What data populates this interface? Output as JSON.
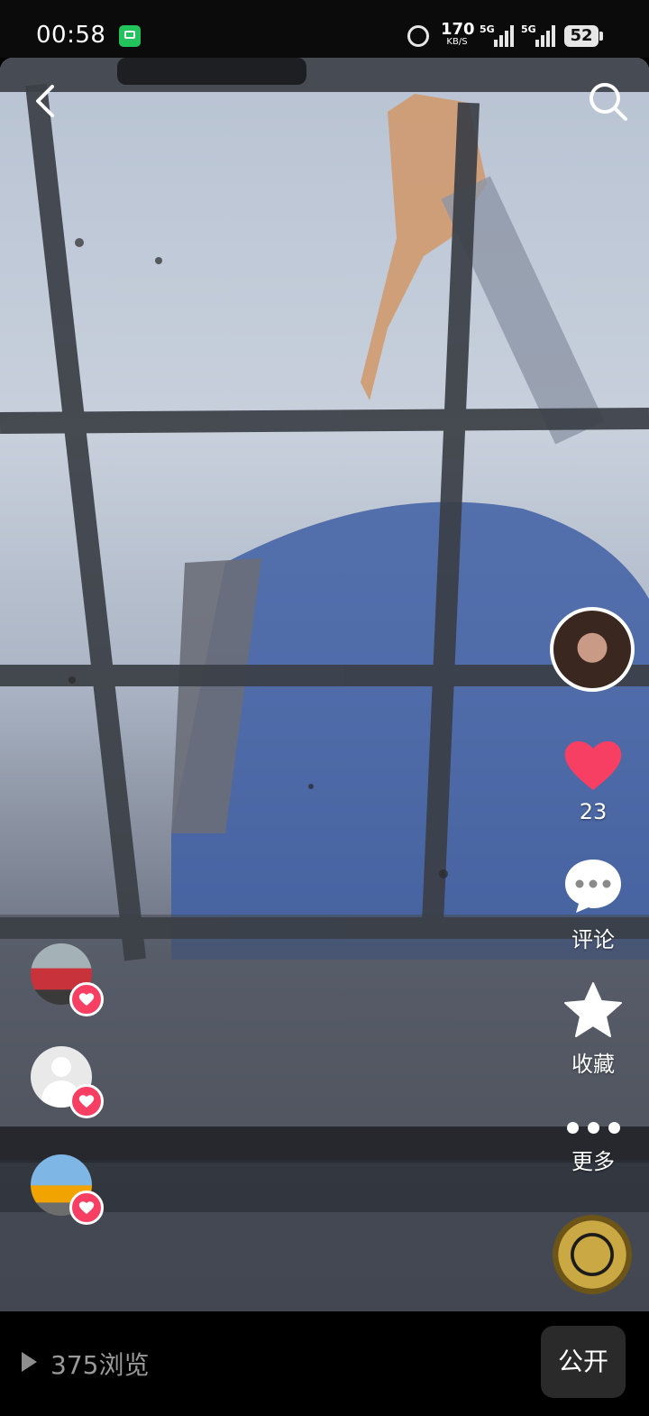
{
  "status_bar": {
    "time": "00:58",
    "net_speed_value": "170",
    "net_speed_unit": "KB/S",
    "sim1_label": "5G",
    "sim2_label": "5G",
    "battery": "52",
    "icons": [
      "message-app-icon",
      "alarm-icon",
      "signal-icon",
      "signal-icon",
      "battery-icon"
    ]
  },
  "header": {
    "back_icon": "chevron-left-icon",
    "search_icon": "search-icon"
  },
  "actions": {
    "like_count": "23",
    "comment_label": "评论",
    "favorite_label": "收藏",
    "more_label": "更多"
  },
  "likers": [
    {
      "avatar": "red-car"
    },
    {
      "avatar": "default-user"
    },
    {
      "avatar": "yellow-crane-truck"
    }
  ],
  "bottom_bar": {
    "views_text": "375浏览",
    "public_label": "公开"
  },
  "colors": {
    "like_red": "#f73f63",
    "badge_border": "#ffffff",
    "bottom_bg": "#000000",
    "public_button_bg": "#2a2a2a"
  }
}
